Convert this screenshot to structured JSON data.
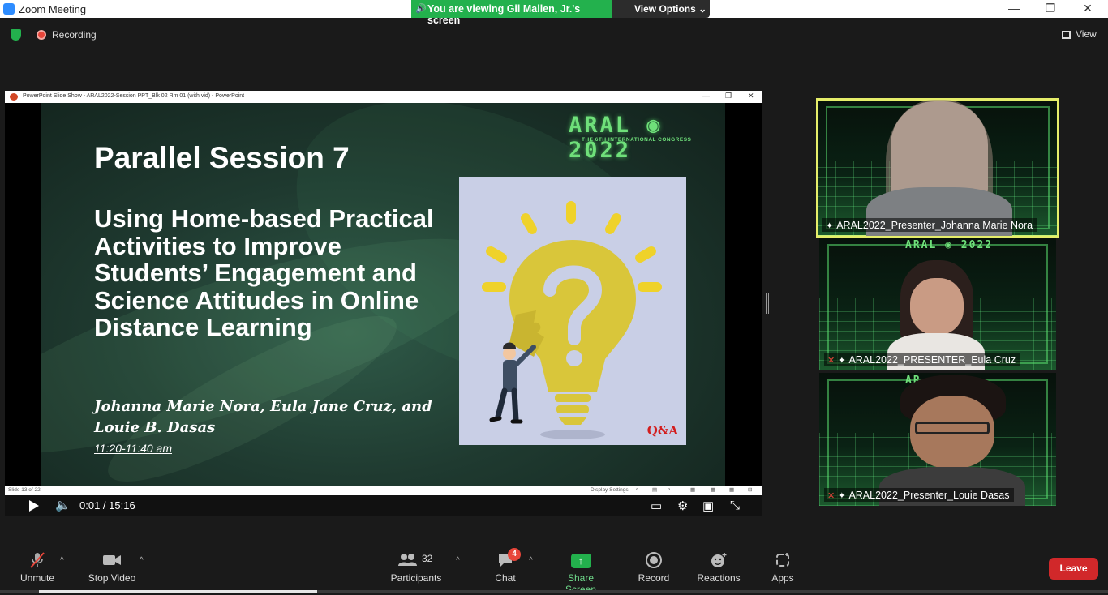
{
  "window": {
    "title": "Zoom Meeting",
    "controls": [
      "—",
      "❐",
      "✕"
    ]
  },
  "banner": {
    "text": "You are viewing Gil Mallen, Jr.'s screen",
    "view_options": "View Options ⌄"
  },
  "top": {
    "recording": "Recording",
    "view": "View"
  },
  "share_window": {
    "title": "PowerPoint Slide Show  -  ARAL2022-Session PPT_Blk 02 Rm 01 (with vid) - PowerPoint",
    "slide_status": "Slide 13 of 22",
    "display_settings": "Display Settings"
  },
  "slide": {
    "logo": "ARAL ◉ 2022",
    "logo_sub": "THE 6TH INTERNATIONAL CONGRESS",
    "title": "Parallel Session 7",
    "subtitle": "Using Home-based Practical Activities to Improve Students’ Engagement and Science Attitudes in Online Distance Learning",
    "authors": "Johanna Marie Nora, Eula Jane Cruz, and Louie B. Dasas",
    "time": "11:20-11:40 am",
    "qa_label": "Q&A"
  },
  "video_player": {
    "time": "0:01 / 15:16"
  },
  "participants_panel": [
    {
      "name": "ARAL2022_Presenter_Johanna Marie Nora",
      "active": true,
      "muted": false
    },
    {
      "name": "ARAL2022_PRESENTER_Eula Cruz",
      "active": false,
      "muted": true,
      "logo": "ARAL ◉ 2022"
    },
    {
      "name": "ARAL2022_Presenter_Louie Dasas",
      "active": false,
      "muted": true,
      "logo": "AR"
    }
  ],
  "toolbar": {
    "unmute": "Unmute",
    "stop_video": "Stop Video",
    "participants": "Participants",
    "participants_count": "32",
    "chat": "Chat",
    "chat_badge": "4",
    "share_screen": "Share Screen",
    "record": "Record",
    "reactions": "Reactions",
    "apps": "Apps",
    "leave": "Leave"
  },
  "colors": {
    "banner_green": "#23b14d",
    "leave_red": "#d1282a",
    "active_speaker_outline": "#e6ee6a",
    "slide_logo_green": "#6fe07a"
  }
}
